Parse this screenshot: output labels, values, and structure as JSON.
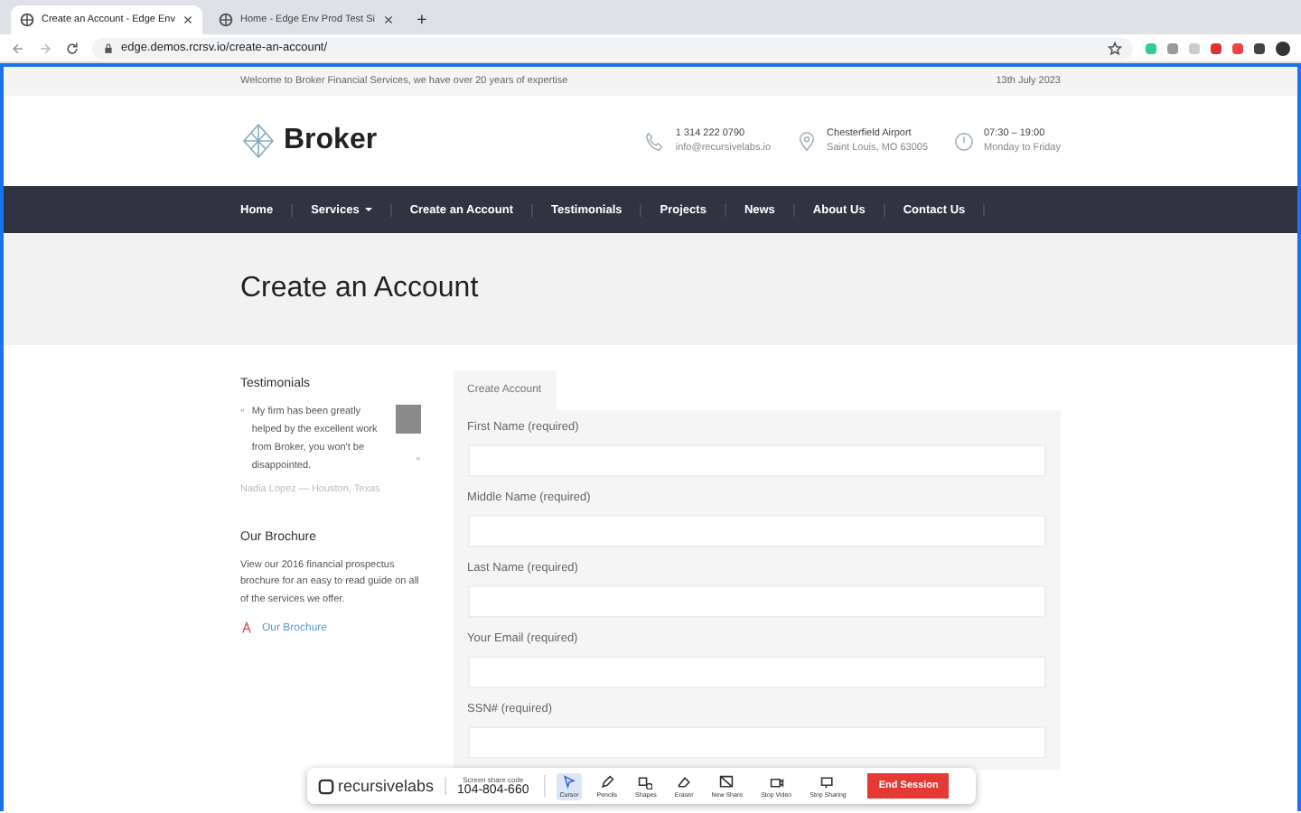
{
  "browser": {
    "tabs": [
      {
        "title": "Create an Account - Edge Env",
        "selected": true
      },
      {
        "title": "Home - Edge Env Prod Test Si",
        "selected": false
      }
    ],
    "new_tab": "+",
    "url": "edge.demos.rcrsv.io/create-an-account/"
  },
  "top_bar": {
    "welcome": "Welcome to Broker Financial Services, we have over 20 years of expertise",
    "date": "13th July 2023"
  },
  "header": {
    "logo": "Broker",
    "contacts": [
      {
        "kind": "phone",
        "line1": "1 314 222 0790",
        "line2": "info@recursivelabs.io"
      },
      {
        "kind": "location",
        "line1": "Chesterfield Airport",
        "line2": "Saint Louis, MO 63005"
      },
      {
        "kind": "clock",
        "line1": "07:30 – 19:00",
        "line2": "Monday to Friday"
      }
    ]
  },
  "nav": [
    {
      "label": "Home",
      "dropdown": false
    },
    {
      "label": "Services",
      "dropdown": true
    },
    {
      "label": "Create an Account",
      "dropdown": false
    },
    {
      "label": "Testimonials",
      "dropdown": false
    },
    {
      "label": "Projects",
      "dropdown": false
    },
    {
      "label": "News",
      "dropdown": false
    },
    {
      "label": "About Us",
      "dropdown": false
    },
    {
      "label": "Contact Us",
      "dropdown": false
    }
  ],
  "page_title": "Create an Account",
  "sidebar": {
    "testimonials_heading": "Testimonials",
    "open_quote": "“",
    "quote": "My firm has been greatly helped by the excellent work from Broker, you won't be disappointed.",
    "close_quote": "”",
    "author": "Nadia Lopez — Houston, Texas",
    "brochure_heading": "Our Brochure",
    "brochure_text": "View our 2016 financial prospectus brochure for an easy to read guide on all of the services we offer.",
    "brochure_link": "Our Brochure"
  },
  "form": {
    "tab": "Create Account",
    "fields": [
      {
        "label": "First Name (required)"
      },
      {
        "label": "Middle Name (required)"
      },
      {
        "label": "Last Name (required)"
      },
      {
        "label": "Your Email (required)"
      },
      {
        "label": "SSN# (required)"
      }
    ]
  },
  "share_toolbar": {
    "logo": "recursivelabs",
    "code_label": "Screen share code",
    "code": "104-804-660",
    "tools": [
      {
        "kind": "cursor",
        "label": "Cursor",
        "selected": true
      },
      {
        "kind": "pencil",
        "label": "Pencils",
        "selected": false
      },
      {
        "kind": "shapes",
        "label": "Shapes",
        "selected": false
      },
      {
        "kind": "eraser",
        "label": "Eraser",
        "selected": false
      },
      {
        "kind": "share",
        "label": "New Share",
        "selected": false
      },
      {
        "kind": "video",
        "label": "Stop Video",
        "selected": false
      },
      {
        "kind": "screen",
        "label": "Stop Sharing",
        "selected": false
      }
    ],
    "end_button": "End Session"
  }
}
